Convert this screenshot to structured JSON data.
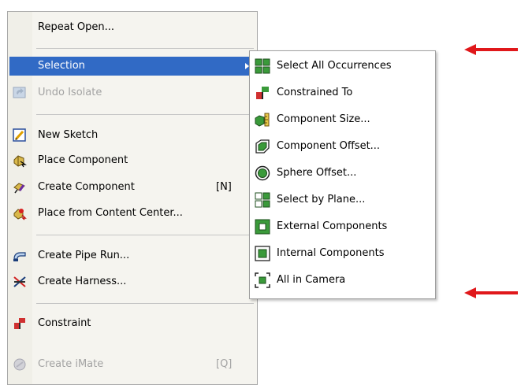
{
  "main_menu": {
    "repeat_open": "Repeat Open...",
    "selection": "Selection",
    "undo_isolate": "Undo Isolate",
    "new_sketch": "New Sketch",
    "place_component": "Place Component",
    "create_component": "Create Component",
    "create_component_shortcut": "[N]",
    "place_from_content_center": "Place from Content Center...",
    "create_pipe_run": "Create Pipe Run...",
    "create_harness": "Create Harness...",
    "constraint": "Constraint",
    "create_imate": "Create iMate",
    "create_imate_shortcut": "[Q]"
  },
  "submenu": {
    "select_all_occurrences": "Select All Occurrences",
    "constrained_to": "Constrained To",
    "component_size": "Component Size...",
    "component_offset": "Component Offset...",
    "sphere_offset": "Sphere Offset...",
    "select_by_plane": "Select by Plane...",
    "external_components": "External Components",
    "internal_components": "Internal Components",
    "all_in_camera": "All in Camera"
  },
  "colors": {
    "highlight": "#316ac5",
    "disabled_text": "#a3a3a3",
    "annotation_arrow": "#e0181b"
  }
}
